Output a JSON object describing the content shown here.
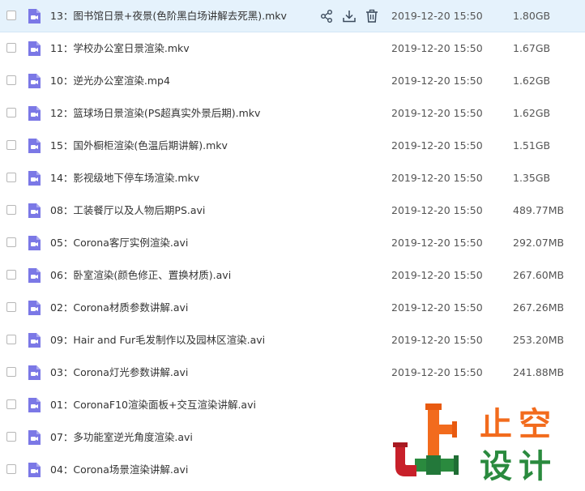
{
  "files": [
    {
      "name": "13：图书馆日景+夜景(色阶黑白场讲解去死黑).mkv",
      "date": "2019-12-20 15:50",
      "size": "1.80GB",
      "highlighted": true
    },
    {
      "name": "11：学校办公室日景渲染.mkv",
      "date": "2019-12-20 15:50",
      "size": "1.67GB"
    },
    {
      "name": "10：逆光办公室渲染.mp4",
      "date": "2019-12-20 15:50",
      "size": "1.62GB"
    },
    {
      "name": "12：篮球场日景渲染(PS超真实外景后期).mkv",
      "date": "2019-12-20 15:50",
      "size": "1.62GB"
    },
    {
      "name": "15：国外橱柜渲染(色温后期讲解).mkv",
      "date": "2019-12-20 15:50",
      "size": "1.51GB"
    },
    {
      "name": "14：影视级地下停车场渲染.mkv",
      "date": "2019-12-20 15:50",
      "size": "1.35GB"
    },
    {
      "name": "08：工装餐厅以及人物后期PS.avi",
      "date": "2019-12-20 15:50",
      "size": "489.77MB"
    },
    {
      "name": "05：Corona客厅实例渲染.avi",
      "date": "2019-12-20 15:50",
      "size": "292.07MB"
    },
    {
      "name": "06：卧室渲染(颜色修正、置换材质).avi",
      "date": "2019-12-20 15:50",
      "size": "267.60MB"
    },
    {
      "name": "02：Corona材质参数讲解.avi",
      "date": "2019-12-20 15:50",
      "size": "267.26MB"
    },
    {
      "name": "09：Hair and Fur毛发制作以及园林区渲染.avi",
      "date": "2019-12-20 15:50",
      "size": "253.20MB"
    },
    {
      "name": "03：Corona灯光参数讲解.avi",
      "date": "2019-12-20 15:50",
      "size": "241.88MB"
    },
    {
      "name": "01：CoronaF10渲染面板+交互渲染讲解.avi",
      "date": "",
      "size": ""
    },
    {
      "name": "07：多功能室逆光角度渲染.avi",
      "date": "",
      "size": ""
    },
    {
      "name": "04：Corona场景渲染讲解.avi",
      "date": "",
      "size": ""
    }
  ],
  "row_actions": [
    "share-icon",
    "download-icon",
    "delete-icon"
  ],
  "icons": {
    "file": "video-file-icon",
    "watermark": "pipe-logo"
  },
  "colors": {
    "icon_purple": "#7b78e6",
    "row_highlight": "#e5f2fc",
    "action_icon": "#3b4a5c",
    "text": "#333333",
    "watermark_orange": "#f26b1d",
    "watermark_green": "#2a8a3e",
    "watermark_red": "#c8202a"
  },
  "watermark": {
    "line1": "止空",
    "line2": "设计"
  }
}
